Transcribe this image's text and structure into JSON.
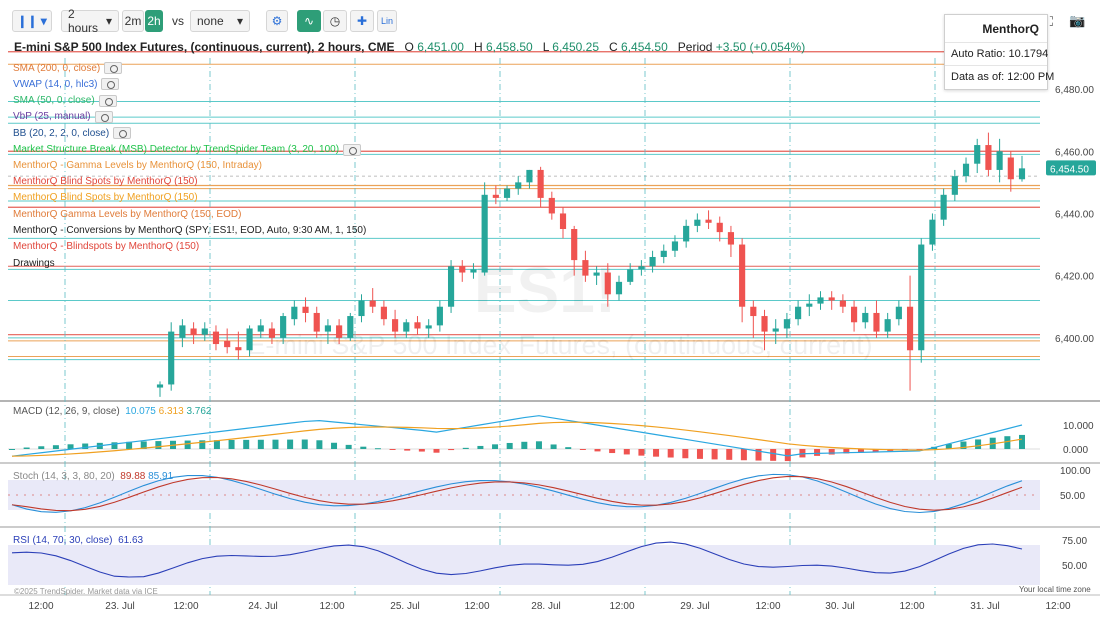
{
  "toolbar": {
    "interval": "2 hours",
    "tf_2m": "2m",
    "tf_2h": "2h",
    "vs": "vs",
    "compare": "none",
    "lin": "Lin"
  },
  "header": {
    "symbol_title": "E-mini S&P 500 Index Futures, (continuous, current), 2 hours, CME",
    "open_label": "O",
    "open": "6,451.00",
    "high_label": "H",
    "high": "6,458.50",
    "low_label": "L",
    "low": "6,450.25",
    "close_label": "C",
    "close": "6,454.50",
    "period_label": "Period",
    "period_change": "+3.50 (+0.054%)"
  },
  "indicators": [
    {
      "label": "SMA (200, 0, close)",
      "color": "#e07b39",
      "eye": true
    },
    {
      "label": "VWAP (14, 0, hlc3)",
      "color": "#3a6fd8",
      "eye": true
    },
    {
      "label": "SMA (50, 0, close)",
      "color": "#2fb86b",
      "eye": true
    },
    {
      "label": "VbP (25, manual)",
      "color": "#6b3fa0",
      "eye": true
    },
    {
      "label": "BB (20, 2, 2, 0, close)",
      "color": "#1f4f8f",
      "eye": true
    },
    {
      "label": "Market Structure Break (MSB) Detector by TrendSpider Team (3, 20, 100)",
      "color": "#1fc24a",
      "eye": true
    },
    {
      "label": "MenthorQ - Gamma Levels by MenthorQ (150, Intraday)",
      "color": "#e8923a",
      "eye": false
    },
    {
      "label": "MenthorQ Blind Spots by MenthorQ (150)",
      "color": "#e0453a",
      "eye": false
    },
    {
      "label": "MenthorQ Blind Spots by MenthorQ (150)",
      "color": "#f0a020",
      "eye": false
    },
    {
      "label": "MenthorQ Gamma Levels by MenthorQ (150, EOD)",
      "color": "#e07b39",
      "eye": false
    },
    {
      "label": "MenthorQ - Conversions by MenthorQ (SPY, ES1!, EOD, Auto, 9:30 AM, 1, 150)",
      "color": "#222222",
      "eye": false
    },
    {
      "label": "MenthorQ - Blindspots by MenthorQ (150)",
      "color": "#e0453a",
      "eye": false
    },
    {
      "label": "Drawings",
      "color": "#222222",
      "eye": false
    }
  ],
  "infobox": {
    "title": "MenthorQ",
    "auto_ratio": "Auto Ratio: 10.1794",
    "data_as_of": "Data as of: 12:00 PM"
  },
  "watermark": {
    "symbol": "ES1!",
    "name": "E-mini S&P 500 Index Futures, (continuous, current)"
  },
  "price_axis": {
    "ticks": [
      "6,480.00",
      "6,460.00",
      "6,440.00",
      "6,420.00",
      "6,400.00"
    ],
    "last_price": "6,454.50"
  },
  "macd": {
    "label": "MACD (12, 26, 9, close)",
    "v1": "10.075",
    "v2": "6.313",
    "v3": "3.762",
    "ticks": [
      "10.000",
      "0.000"
    ]
  },
  "stoch": {
    "label": "Stoch (14, 3, 3, 80, 20)",
    "v1": "89.88",
    "v2": "85.91",
    "ticks": [
      "100.00",
      "50.00"
    ]
  },
  "rsi": {
    "label": "RSI (14, 70, 30, close)",
    "v1": "61.63",
    "ticks": [
      "75.00",
      "50.00"
    ]
  },
  "time_axis": {
    "labels": [
      "12:00",
      "23. Jul",
      "12:00",
      "24. Jul",
      "12:00",
      "25. Jul",
      "12:00",
      "28. Jul",
      "12:00",
      "29. Jul",
      "12:00",
      "30. Jul",
      "12:00",
      "31. Jul",
      "12:00"
    ],
    "local_time": "Your local time zone"
  },
  "copyright": "©2025 TrendSpider. Market data via ICE",
  "colors": {
    "up": "#26a69a",
    "down": "#ef5350",
    "macd_line": "#2aa7e0",
    "signal_line": "#f0a020",
    "stoch_k": "#2a8fd8",
    "stoch_d": "#c0392b",
    "rsi_line": "#2b3fb8",
    "band_fill": "#e9e9f8"
  },
  "chart_data": {
    "type": "candlestick",
    "title": "E-mini S&P 500 Index Futures, (continuous, current), 2 hours, CME",
    "ylim": [
      6380,
      6490
    ],
    "x_labels": [
      "12:00",
      "23. Jul",
      "12:00",
      "24. Jul",
      "12:00",
      "25. Jul",
      "12:00",
      "28. Jul",
      "12:00",
      "29. Jul",
      "12:00",
      "30. Jul",
      "12:00",
      "31. Jul",
      "12:00"
    ],
    "candles": [
      [
        6384,
        6386,
        6381,
        6385
      ],
      [
        6385,
        6405,
        6383,
        6402
      ],
      [
        6400,
        6406,
        6397,
        6404
      ],
      [
        6403,
        6405,
        6398,
        6401
      ],
      [
        6401,
        6405,
        6399,
        6403
      ],
      [
        6402,
        6404,
        6396,
        6398
      ],
      [
        6399,
        6403,
        6395,
        6397
      ],
      [
        6397,
        6402,
        6393,
        6396
      ],
      [
        6396,
        6404,
        6394,
        6403
      ],
      [
        6402,
        6406,
        6400,
        6404
      ],
      [
        6403,
        6405,
        6398,
        6400
      ],
      [
        6400,
        6408,
        6398,
        6407
      ],
      [
        6406,
        6412,
        6404,
        6410
      ],
      [
        6410,
        6413,
        6405,
        6408
      ],
      [
        6408,
        6410,
        6400,
        6402
      ],
      [
        6402,
        6406,
        6398,
        6404
      ],
      [
        6404,
        6406,
        6398,
        6400
      ],
      [
        6400,
        6408,
        6399,
        6407
      ],
      [
        6407,
        6414,
        6405,
        6412
      ],
      [
        6412,
        6416,
        6408,
        6410
      ],
      [
        6410,
        6412,
        6404,
        6406
      ],
      [
        6406,
        6409,
        6400,
        6402
      ],
      [
        6402,
        6406,
        6400,
        6405
      ],
      [
        6405,
        6407,
        6401,
        6403
      ],
      [
        6403,
        6406,
        6400,
        6404
      ],
      [
        6404,
        6412,
        6402,
        6410
      ],
      [
        6410,
        6425,
        6408,
        6423
      ],
      [
        6423,
        6425,
        6418,
        6421
      ],
      [
        6421,
        6424,
        6419,
        6422
      ],
      [
        6421,
        6450,
        6420,
        6446
      ],
      [
        6446,
        6449,
        6443,
        6445
      ],
      [
        6445,
        6449,
        6444,
        6448
      ],
      [
        6448,
        6452,
        6446,
        6450
      ],
      [
        6450,
        6454,
        6448,
        6454
      ],
      [
        6454,
        6455,
        6442,
        6445
      ],
      [
        6445,
        6447,
        6438,
        6440
      ],
      [
        6440,
        6442,
        6432,
        6435
      ],
      [
        6435,
        6436,
        6420,
        6425
      ],
      [
        6425,
        6428,
        6418,
        6420
      ],
      [
        6420,
        6423,
        6417,
        6421
      ],
      [
        6421,
        6424,
        6410,
        6414
      ],
      [
        6414,
        6420,
        6412,
        6418
      ],
      [
        6418,
        6424,
        6417,
        6422
      ],
      [
        6422,
        6425,
        6420,
        6423
      ],
      [
        6423,
        6428,
        6421,
        6426
      ],
      [
        6426,
        6430,
        6424,
        6428
      ],
      [
        6428,
        6433,
        6426,
        6431
      ],
      [
        6431,
        6438,
        6429,
        6436
      ],
      [
        6436,
        6440,
        6434,
        6438
      ],
      [
        6438,
        6441,
        6435,
        6437
      ],
      [
        6437,
        6439,
        6431,
        6434
      ],
      [
        6434,
        6436,
        6426,
        6430
      ],
      [
        6430,
        6432,
        6405,
        6410
      ],
      [
        6410,
        6412,
        6400,
        6407
      ],
      [
        6407,
        6409,
        6396,
        6402
      ],
      [
        6402,
        6406,
        6398,
        6403
      ],
      [
        6403,
        6408,
        6400,
        6406
      ],
      [
        6406,
        6412,
        6404,
        6410
      ],
      [
        6410,
        6414,
        6407,
        6411
      ],
      [
        6411,
        6415,
        6409,
        6413
      ],
      [
        6413,
        6415,
        6409,
        6412
      ],
      [
        6412,
        6414,
        6408,
        6410
      ],
      [
        6410,
        6412,
        6402,
        6405
      ],
      [
        6405,
        6410,
        6403,
        6408
      ],
      [
        6408,
        6412,
        6400,
        6402
      ],
      [
        6402,
        6408,
        6400,
        6406
      ],
      [
        6406,
        6412,
        6404,
        6410
      ],
      [
        6410,
        6420,
        6383,
        6396
      ],
      [
        6396,
        6432,
        6392,
        6430
      ],
      [
        6430,
        6440,
        6428,
        6438
      ],
      [
        6438,
        6448,
        6436,
        6446
      ],
      [
        6446,
        6454,
        6444,
        6452
      ],
      [
        6452,
        6458,
        6450,
        6456
      ],
      [
        6456,
        6464,
        6453,
        6462
      ],
      [
        6462,
        6466,
        6452,
        6454
      ],
      [
        6454,
        6464,
        6450,
        6460
      ],
      [
        6458,
        6460,
        6447,
        6451
      ],
      [
        6451,
        6458.5,
        6450.25,
        6454.5
      ]
    ],
    "macd": {
      "macd_series_name": "MACD",
      "signal_series_name": "Signal"
    },
    "stoch_range": [
      0,
      100
    ],
    "rsi_range": [
      25,
      85
    ]
  }
}
